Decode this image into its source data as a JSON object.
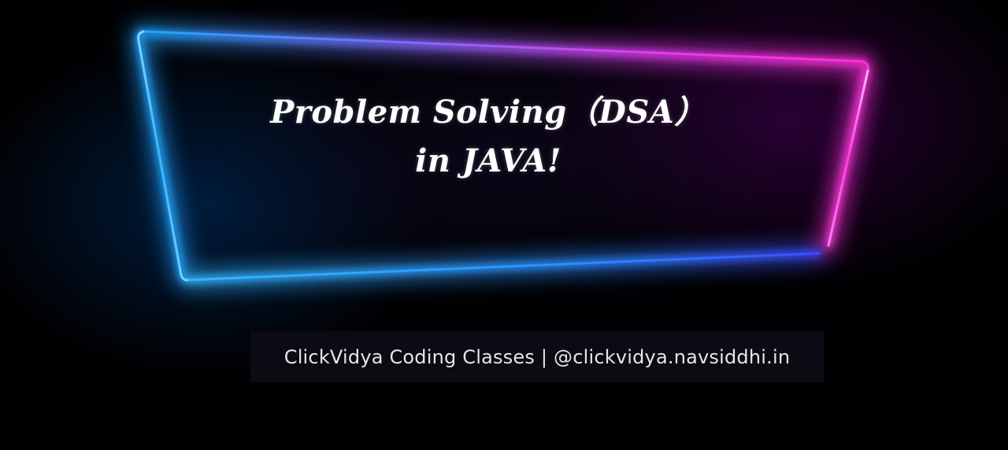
{
  "banner": {
    "title_line1": "Problem Solving（DSA）",
    "title_line2": "in JAVA!",
    "footer_text": "ClickVidya Coding Classes | @clickvidya.navsiddhi.in"
  },
  "colors": {
    "background": "#010103",
    "neon_blue": "#2aa8ff",
    "neon_magenta": "#ff2fd8",
    "text": "#ffffff",
    "footer_bar": "#0c0a12"
  }
}
